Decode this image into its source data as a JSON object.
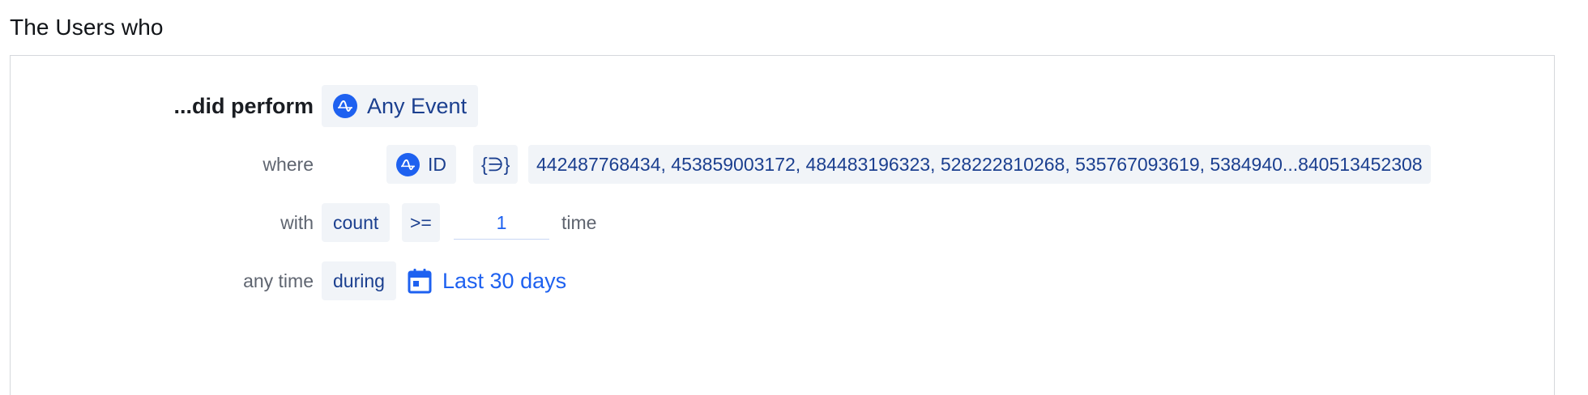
{
  "section": {
    "title": "The Users who"
  },
  "condition": {
    "performed_label": "...did perform",
    "event_name": "Any Event",
    "event_icon": "amplitude-icon",
    "where": {
      "label": "where",
      "property_name": "ID",
      "property_icon": "amplitude-icon",
      "operator": "{∋}",
      "values": "442487768434, 453859003172, 484483196323, 528222810268, 535767093619, 5384940...840513452308"
    },
    "with": {
      "label": "with",
      "metric": "count",
      "comparator": ">=",
      "value": "1",
      "unit": "time"
    },
    "time": {
      "label": "any time",
      "mode": "during",
      "range": "Last 30 days",
      "range_icon": "calendar-icon"
    }
  },
  "colors": {
    "accent": "#1e61f0",
    "pill_bg": "#f1f4f8",
    "pill_text": "#1b3f8f",
    "label_text": "#5f6570",
    "border": "#d5d8dc"
  }
}
